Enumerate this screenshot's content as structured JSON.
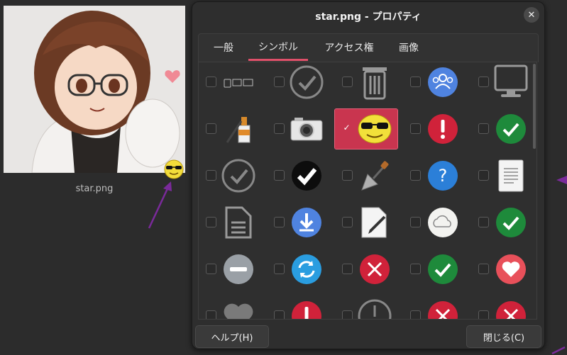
{
  "file": {
    "caption": "star.png"
  },
  "dialog": {
    "title": "star.png - プロパティ",
    "tabs": [
      {
        "label": "一般"
      },
      {
        "label": "シンボル"
      },
      {
        "label": "アクセス権"
      },
      {
        "label": "画像"
      }
    ],
    "active_tab": "シンボル",
    "help_label": "ヘルプ(H)",
    "close_label": "閉じる(C)"
  },
  "emblems": [
    "devices-icon",
    "check-outline-icon",
    "trash-icon",
    "group-icon",
    "monitor-icon",
    "paint-brush-icon",
    "camera-icon",
    "cool-smiley-icon",
    "important-icon",
    "check-green-icon",
    "check-circle-gray-icon",
    "check-black-icon",
    "trowel-icon",
    "question-icon",
    "document-icon",
    "file-icon",
    "download-icon",
    "edit-document-icon",
    "cloud-icon",
    "check-green-icon",
    "minus-icon",
    "sync-icon",
    "cross-red-icon",
    "check-green-icon",
    "heart-icon",
    "heart-gray-icon",
    "important-icon",
    "clock-icon",
    "cross-red-icon",
    "cross-red-icon"
  ],
  "selected_emblem": "cool-smiley-icon",
  "colors": {
    "accent": "#c9354f",
    "green": "#1e8a3b",
    "red": "#d0223a",
    "blue": "#2b7fd8"
  }
}
